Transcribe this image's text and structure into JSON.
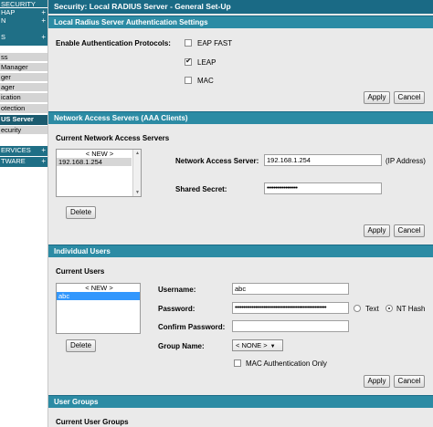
{
  "sidebar": {
    "items": [
      {
        "label": "SECURITY",
        "style": "dark",
        "plus": ""
      },
      {
        "label": "HAP",
        "style": "dark",
        "plus": "+"
      },
      {
        "label": "N",
        "style": "dark",
        "plus": "+"
      },
      {
        "label": "",
        "style": "dark",
        "plus": ""
      },
      {
        "label": "S",
        "style": "dark",
        "plus": "+"
      },
      {
        "label": "ss",
        "style": "light",
        "plus": ""
      },
      {
        "label": "Manager",
        "style": "light",
        "plus": ""
      },
      {
        "label": "ger",
        "style": "light",
        "plus": ""
      },
      {
        "label": "ager",
        "style": "light",
        "plus": ""
      },
      {
        "label": "ication",
        "style": "light",
        "plus": ""
      },
      {
        "label": "otection",
        "style": "light",
        "plus": ""
      },
      {
        "label": "US Server",
        "style": "active",
        "plus": ""
      },
      {
        "label": "ecurity",
        "style": "light",
        "plus": ""
      },
      {
        "label": "ERVICES",
        "style": "dark",
        "plus": "+"
      },
      {
        "label": "TWARE",
        "style": "dark",
        "plus": "+"
      }
    ]
  },
  "page_title": "Security: Local RADIUS Server - General Set-Up",
  "auth_settings": {
    "header": "Local Radius Server Authentication Settings",
    "protocols_label": "Enable Authentication Protocols:",
    "eap_fast": {
      "label": "EAP FAST",
      "checked": false
    },
    "leap": {
      "label": "LEAP",
      "checked": true
    },
    "mac": {
      "label": "MAC",
      "checked": false
    },
    "apply": "Apply",
    "cancel": "Cancel"
  },
  "nas": {
    "header": "Network Access Servers (AAA Clients)",
    "current_label": "Current Network Access Servers",
    "list": [
      "< NEW >",
      "192.168.1.254"
    ],
    "delete": "Delete",
    "server_label": "Network Access Server:",
    "server_value": "192.168.1.254",
    "server_hint": "(IP Address)",
    "secret_label": "Shared Secret:",
    "secret_value": "••••••••••••••••••",
    "apply": "Apply",
    "cancel": "Cancel"
  },
  "users": {
    "header": "Individual Users",
    "current_label": "Current Users",
    "list": [
      "< NEW >",
      "abc"
    ],
    "delete": "Delete",
    "username_label": "Username:",
    "username_value": "abc",
    "password_label": "Password:",
    "password_value": "••••••••••••••••••••••••••••••••••••••••••••••••••••••",
    "text_option": "Text",
    "nthash_option": "NT Hash",
    "selected_hash": "NT Hash",
    "confirm_label": "Confirm Password:",
    "confirm_value": "",
    "group_label": "Group Name:",
    "group_value": "< NONE >",
    "mac_auth_label": "MAC Authentication Only",
    "mac_auth_checked": false,
    "apply": "Apply",
    "cancel": "Cancel"
  },
  "groups": {
    "header": "User Groups",
    "current_label": "Current User Groups"
  },
  "colors": {
    "title_bar": "#1a6a85",
    "section_header": "#2c8ba4",
    "sidebar_dark": "#1f6f86",
    "selection": "#3297fd"
  }
}
